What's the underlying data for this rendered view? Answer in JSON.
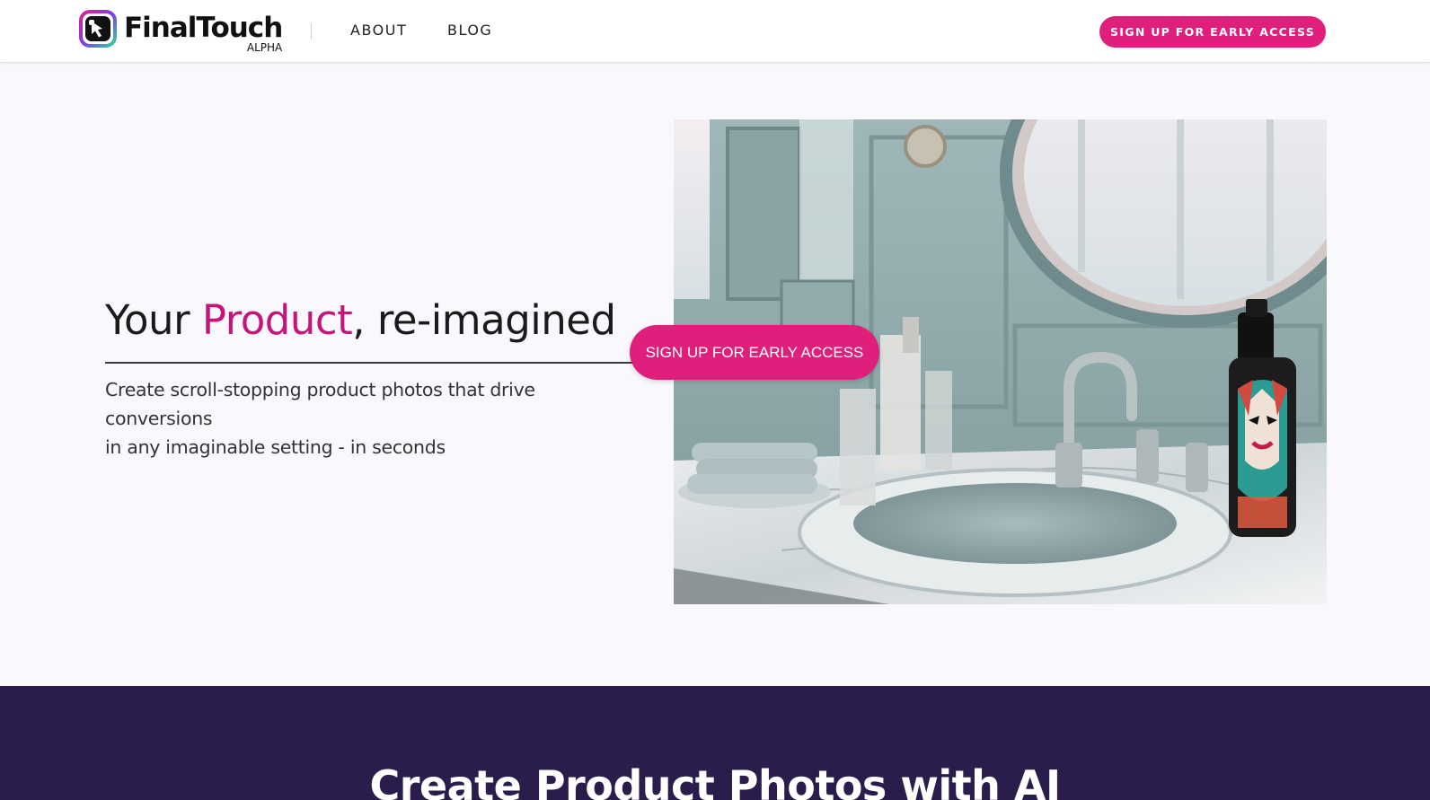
{
  "header": {
    "logo_name": "FinalTouch",
    "logo_tag": "ALPHA",
    "nav": [
      {
        "label": "ABOUT"
      },
      {
        "label": "BLOG"
      }
    ],
    "cta_label": "SIGN UP FOR EARLY ACCESS"
  },
  "hero": {
    "title_prefix": "Your ",
    "title_accent": "Product",
    "title_suffix": ", re-imagined",
    "subtitle_line1": "Create scroll-stopping product photos that drive conversions",
    "subtitle_line2": "in any imaginable setting - in seconds",
    "cta_label": "SIGN UP FOR EARLY ACCESS"
  },
  "section": {
    "title": "Create Product Photos with AI"
  },
  "colors": {
    "accent": "#e01e7c",
    "accent_text": "#c5157a",
    "band_bg": "#2a1d4c"
  }
}
